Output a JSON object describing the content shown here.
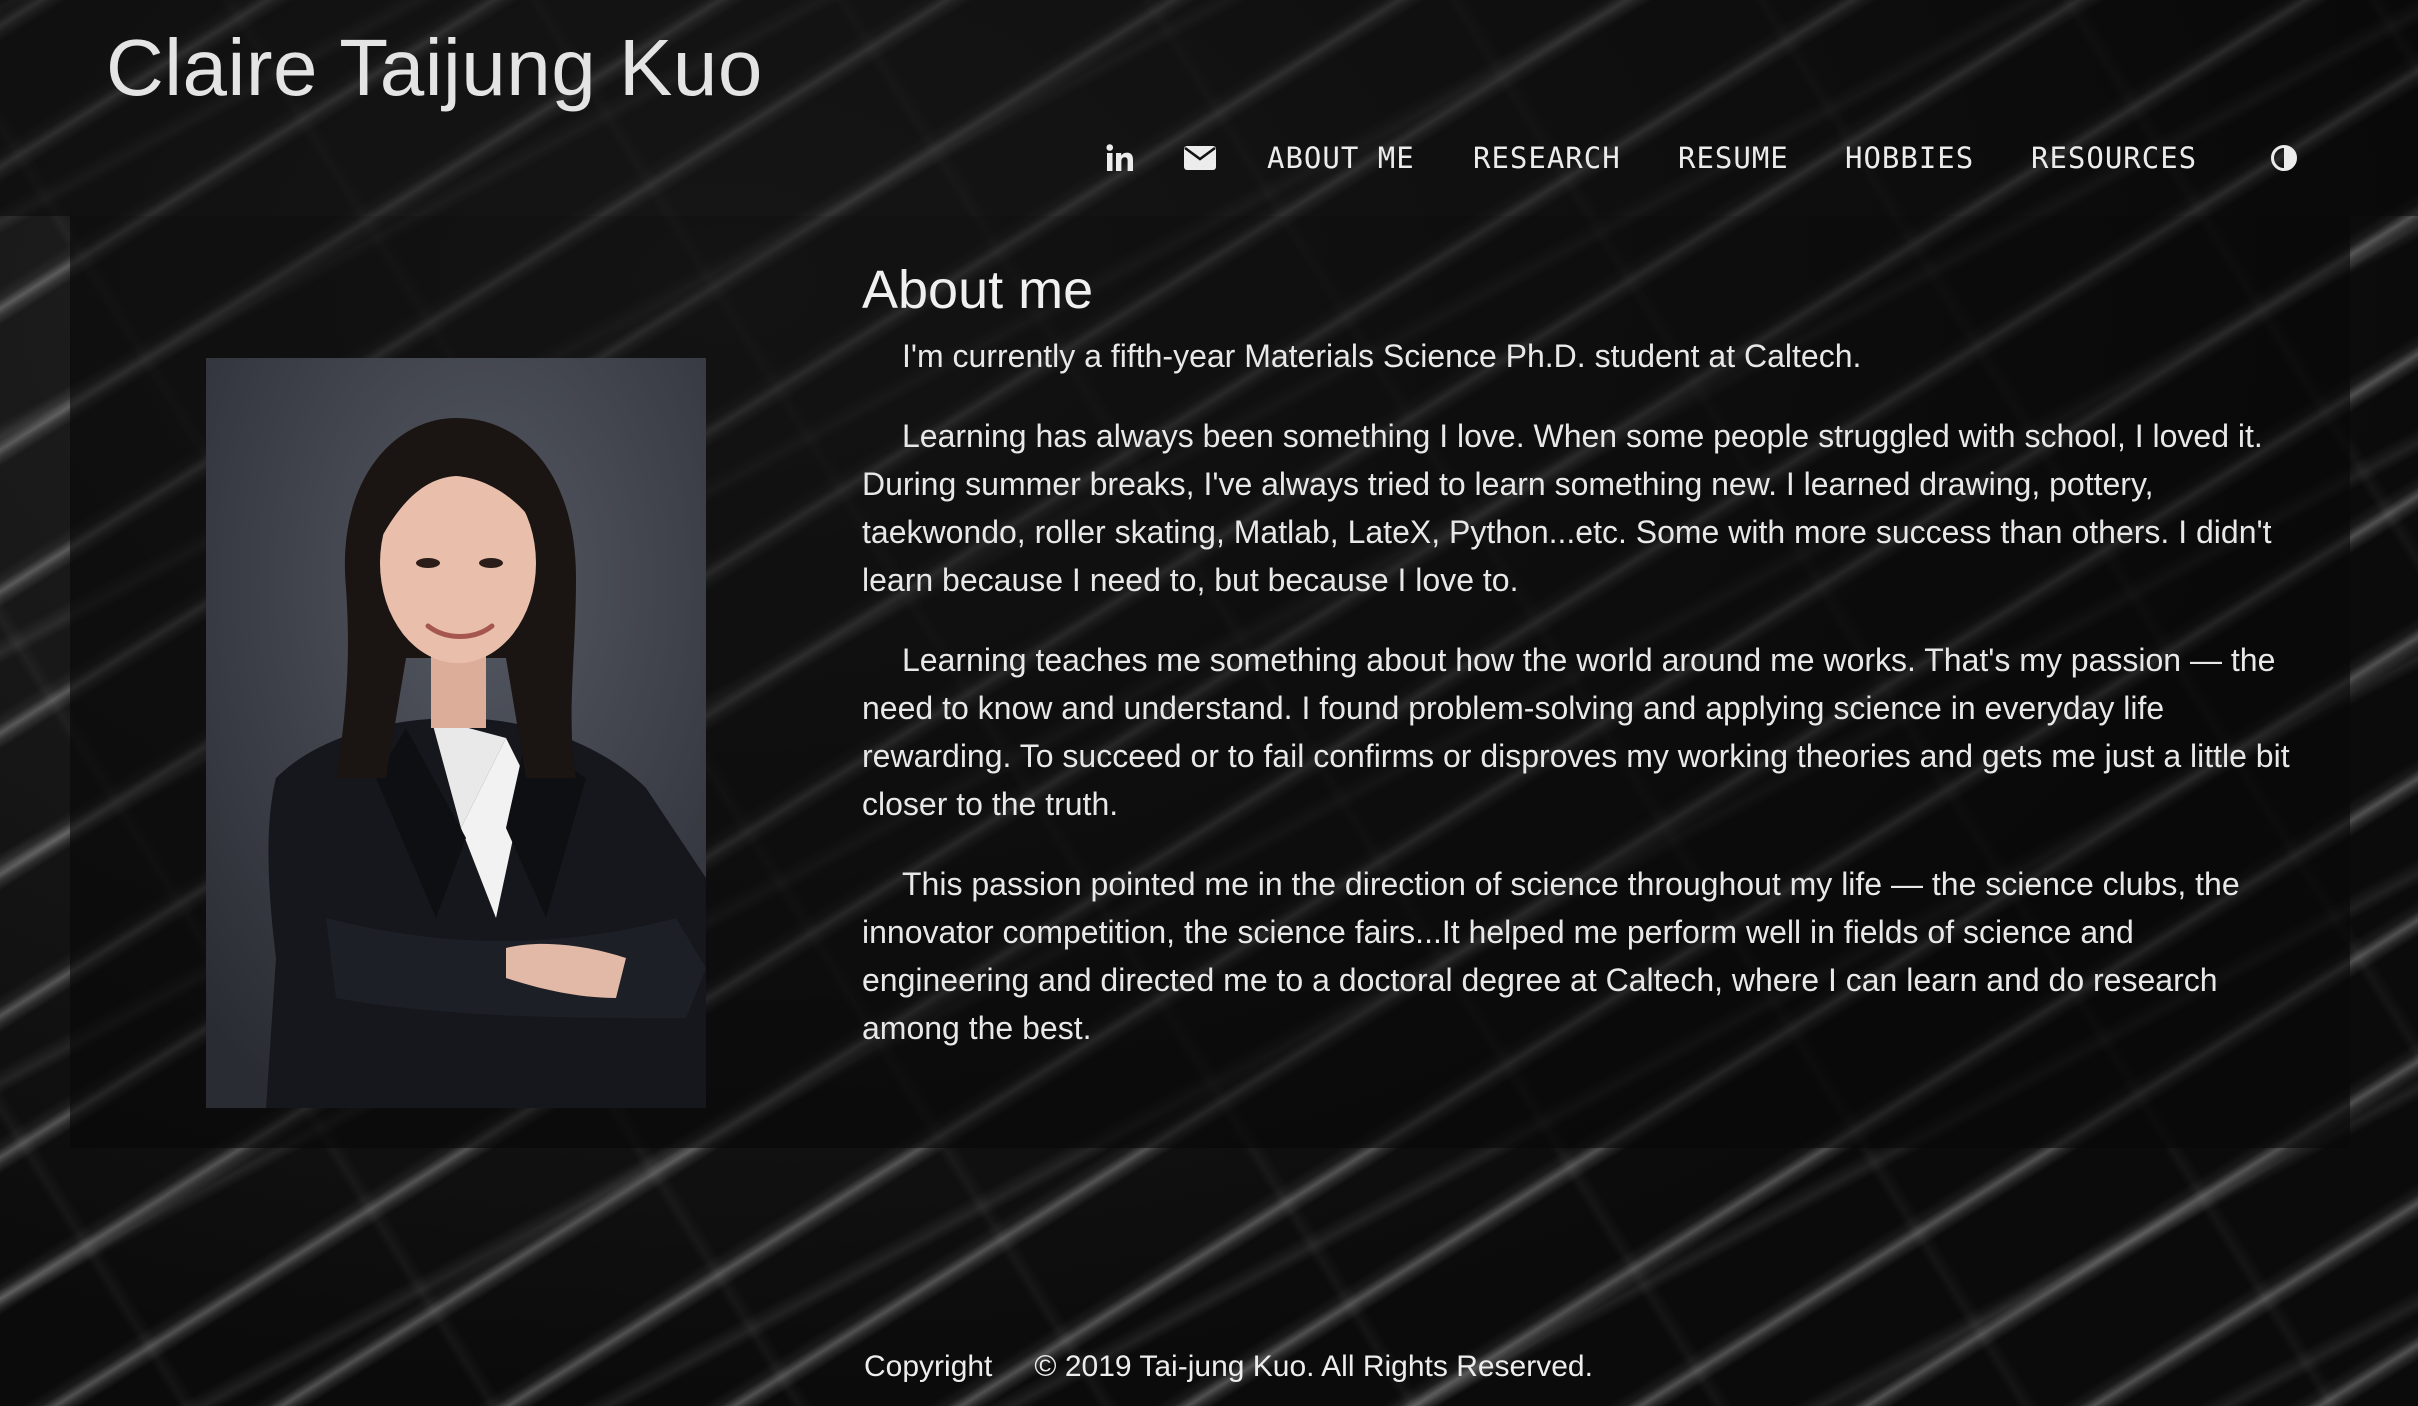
{
  "site": {
    "title": "Claire Taijung Kuo"
  },
  "nav": {
    "linkedin_icon": "linkedin-icon",
    "email_icon": "envelope-icon",
    "items": [
      {
        "label": "ABOUT ME"
      },
      {
        "label": "RESEARCH"
      },
      {
        "label": "RESUME"
      },
      {
        "label": "HOBBIES"
      },
      {
        "label": "RESOURCES"
      }
    ],
    "theme_icon": "contrast-icon"
  },
  "about": {
    "heading": "About me",
    "paragraphs": [
      "I'm currently a fifth-year Materials Science Ph.D. student at Caltech.",
      "Learning has always been something I love. When some people struggled with school, I loved it. During summer breaks, I've always tried to learn something new. I learned drawing, pottery, taekwondo, roller skating, Matlab, LateX, Python...etc. Some with more success than others. I didn't learn because I need to, but because I love to.",
      "Learning teaches me something about how the world around me works. That's my passion — the need to know and understand. I found problem-solving and applying science in everyday life rewarding. To succeed or to fail confirms or disproves my working theories and gets me just a little bit closer to the truth.",
      "This passion pointed me in the direction of science throughout my life — the science clubs, the innovator competition, the science fairs...It helped me perform well in fields of science and engineering and directed me to a doctoral degree at Caltech, where I can learn and do research among the best."
    ]
  },
  "footer": {
    "label": "Copyright",
    "text": "© 2019 Tai-jung Kuo. All Rights Reserved."
  },
  "colors": {
    "background": "#0d0d0d",
    "text": "#e6e6e6"
  }
}
